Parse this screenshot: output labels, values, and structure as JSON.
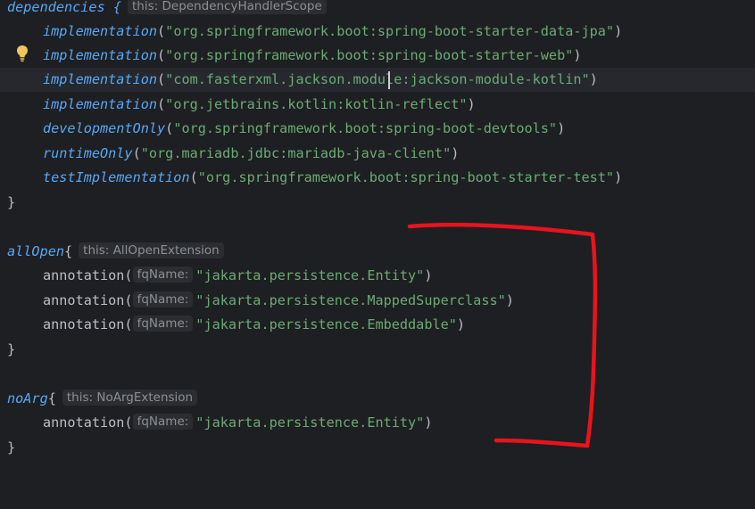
{
  "lines": [
    {
      "code": "dependencies {",
      "hint": "this: DependencyHandlerScope"
    },
    {
      "fn": "implementation",
      "arg": "\"org.springframework.boot:spring-boot-starter-data-jpa\""
    },
    {
      "fn": "implementation",
      "arg": "\"org.springframework.boot:spring-boot-starter-web\""
    },
    {
      "fn": "implementation",
      "arg": "\"com.fasterxml.jackson.module:jackson-module-kotlin\""
    },
    {
      "fn": "implementation",
      "arg": "\"org.jetbrains.kotlin:kotlin-reflect\""
    },
    {
      "fn": "developmentOnly",
      "arg": "\"org.springframework.boot:spring-boot-devtools\""
    },
    {
      "fn": "runtimeOnly",
      "arg": "\"org.mariadb.jdbc:mariadb-java-client\""
    },
    {
      "fn": "testImplementation",
      "arg": "\"org.springframework.boot:spring-boot-starter-test\""
    },
    {
      "brace": "}"
    },
    {
      "fn": "allOpen",
      "brace": "{",
      "hint": "this: AllOpenExtension"
    },
    {
      "call": "annotation(",
      "param": "fqName:",
      "arg": "\"jakarta.persistence.Entity\"",
      "close": ")"
    },
    {
      "call": "annotation(",
      "param": "fqName:",
      "arg": "\"jakarta.persistence.MappedSuperclass\"",
      "close": ")"
    },
    {
      "call": "annotation(",
      "param": "fqName:",
      "arg": "\"jakarta.persistence.Embeddable\"",
      "close": ")"
    },
    {
      "brace": "}"
    },
    {
      "fn": "noArg",
      "brace": "{",
      "hint": "this: NoArgExtension"
    },
    {
      "call": "annotation(",
      "param": "fqName:",
      "arg": "\"jakarta.persistence.Entity\"",
      "close": ")"
    },
    {
      "brace": "}"
    }
  ],
  "punct": {
    "open_paren": "(",
    "close_paren": ")"
  },
  "colors": {
    "background": "#1e1f22",
    "function": "#56a8f5",
    "string": "#6aab73",
    "text": "#bcbec4",
    "hint_bg": "#2b2d30",
    "hint_text": "#8c8f94",
    "annotation_stroke": "#e8141c",
    "bulb": "#f2c55c"
  },
  "icons": {
    "gutter": "lightbulb-icon"
  },
  "annotation": {
    "shape": "red-hand-drawn-bracket"
  }
}
